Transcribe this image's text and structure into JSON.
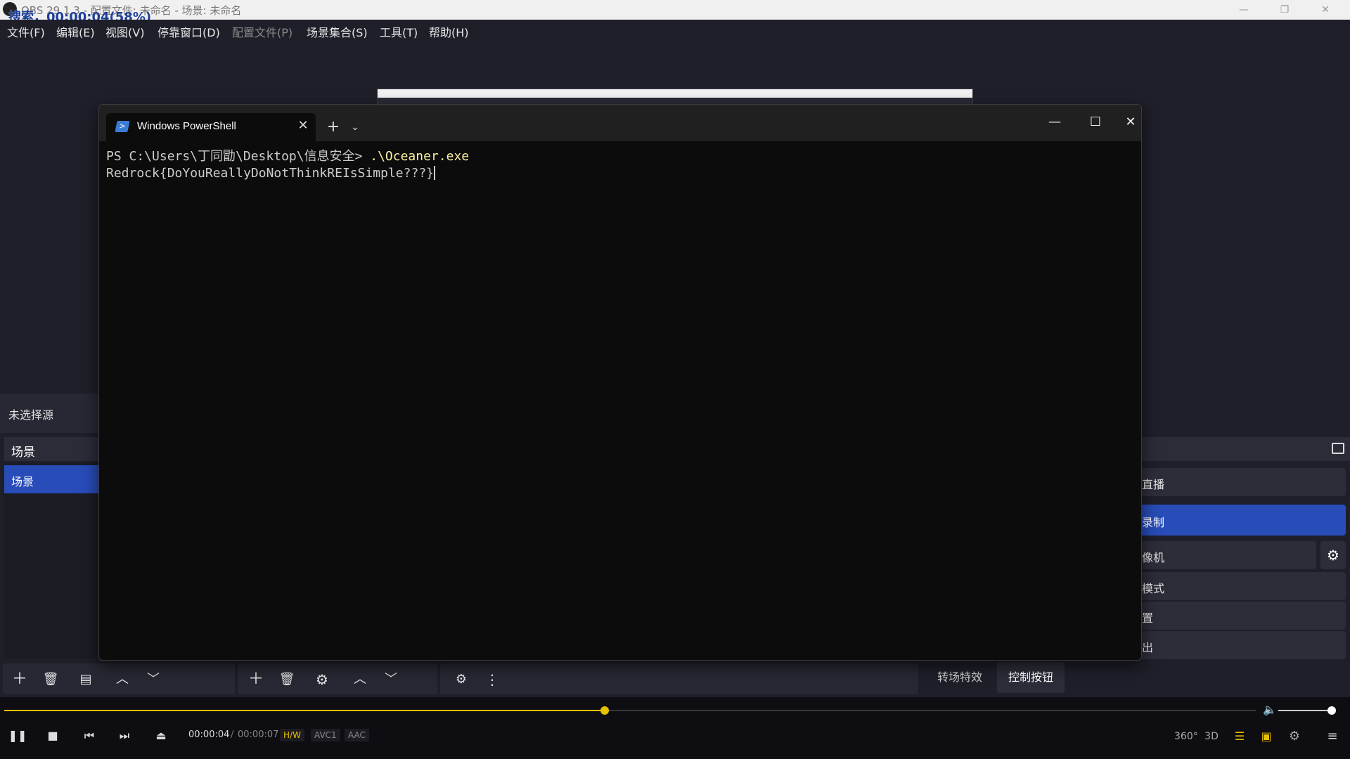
{
  "obs": {
    "window_title": "OBS 29.1.3 - 配置文件: 未命名 - 场景: 未命名",
    "overlay_text": "搜索，00:00:04(58%)",
    "menu": [
      {
        "label": "文件(F)",
        "dim": false
      },
      {
        "label": "编辑(E)",
        "dim": false
      },
      {
        "label": "视图(V)",
        "dim": false
      },
      {
        "label": "停靠窗口(D)",
        "dim": false
      },
      {
        "label": "配置文件(P)",
        "dim": true
      },
      {
        "label": "场景集合(S)",
        "dim": false
      },
      {
        "label": "工具(T)",
        "dim": false
      },
      {
        "label": "帮助(H)",
        "dim": false
      }
    ],
    "no_source_label": "未选择源",
    "scenes_header": "场景",
    "scene_item": "场景",
    "controls": {
      "stream": "直播",
      "record": "录制",
      "virtual_cam": "像机",
      "studio_mode": "模式",
      "settings": "置",
      "exit": "出"
    },
    "tabs": {
      "transitions": "转场特效",
      "controls": "控制按钮"
    }
  },
  "powershell": {
    "tab_title": "Windows PowerShell",
    "prompt": "PS C:\\Users\\丁同勖\\Desktop\\信息安全> ",
    "command": ".\\Oceaner.exe",
    "output": "Redrock{DoYouReallyDoNotThinkREIsSimple???}"
  },
  "player": {
    "current_time": "00:00:04",
    "separator": "/",
    "total_time": "00:00:07",
    "badges": {
      "hw": "H/W",
      "video": "AVC1",
      "audio": "AAC"
    },
    "progress_fraction": 0.48,
    "volume_fraction": 0.9,
    "icons": {
      "r360": "360°",
      "r3d": "3D"
    }
  },
  "colors": {
    "accent": "#284cb8",
    "player_accent": "#e6c100",
    "ps_bg": "#0c0c0c"
  }
}
